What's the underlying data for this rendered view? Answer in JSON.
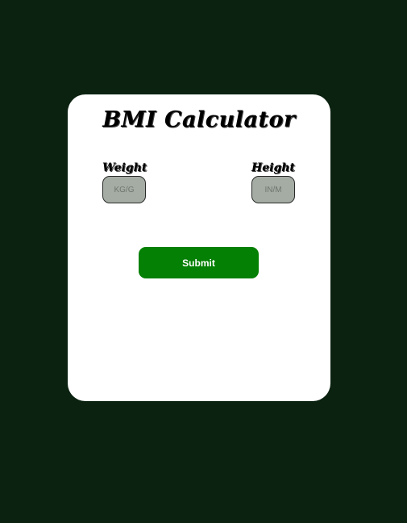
{
  "app": {
    "title": "BMI Calculator"
  },
  "form": {
    "weight": {
      "label": "Weight",
      "value": "",
      "placeholder": "KG/G"
    },
    "height": {
      "label": "Height",
      "value": "",
      "placeholder": "IN/M"
    },
    "submit_label": "Submit"
  },
  "colors": {
    "background": "#0b2210",
    "card": "#ffffff",
    "input_fill": "#a4aca4",
    "submit_button": "#048004",
    "submit_text": "#ffffff"
  }
}
